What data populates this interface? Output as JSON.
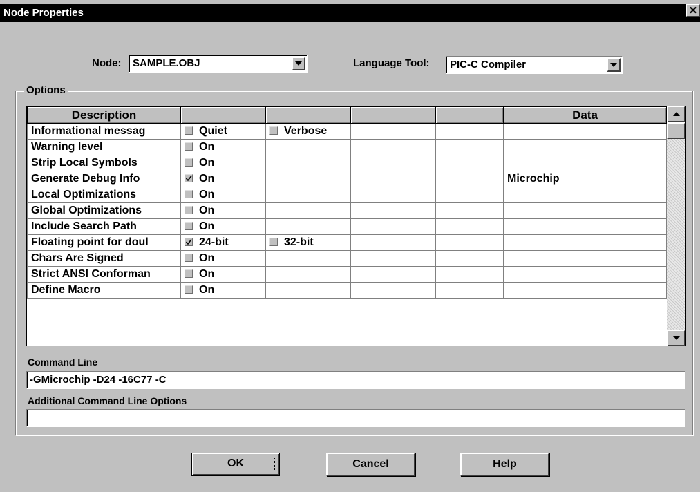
{
  "window": {
    "title": "Node Properties",
    "close_glyph": "✕"
  },
  "node": {
    "label": "Node:",
    "value": "SAMPLE.OBJ"
  },
  "language_tool": {
    "label": "Language Tool:",
    "value": "PIC-C Compiler"
  },
  "options": {
    "group_label": "Options",
    "columns": [
      "Description",
      "",
      "",
      "",
      "",
      "Data"
    ],
    "rows": [
      {
        "description": "Informational messag",
        "opt1": {
          "label": "Quiet",
          "checked": false
        },
        "opt2": {
          "label": "Verbose",
          "checked": false
        },
        "data": ""
      },
      {
        "description": "Warning level",
        "opt1": {
          "label": "On",
          "checked": false
        },
        "opt2": null,
        "data": ""
      },
      {
        "description": "Strip Local Symbols",
        "opt1": {
          "label": "On",
          "checked": false
        },
        "opt2": null,
        "data": ""
      },
      {
        "description": "Generate Debug Info",
        "opt1": {
          "label": "On",
          "checked": true
        },
        "opt2": null,
        "data": "Microchip"
      },
      {
        "description": "Local Optimizations",
        "opt1": {
          "label": "On",
          "checked": false
        },
        "opt2": null,
        "data": ""
      },
      {
        "description": "Global Optimizations",
        "opt1": {
          "label": "On",
          "checked": false
        },
        "opt2": null,
        "data": ""
      },
      {
        "description": "Include Search Path",
        "opt1": {
          "label": "On",
          "checked": false
        },
        "opt2": null,
        "data": ""
      },
      {
        "description": "Floating point for doul",
        "opt1": {
          "label": "24-bit",
          "checked": true
        },
        "opt2": {
          "label": "32-bit",
          "checked": false
        },
        "data": ""
      },
      {
        "description": "Chars Are Signed",
        "opt1": {
          "label": "On",
          "checked": false
        },
        "opt2": null,
        "data": ""
      },
      {
        "description": "Strict ANSI Conforman",
        "opt1": {
          "label": "On",
          "checked": false
        },
        "opt2": null,
        "data": ""
      },
      {
        "description": "Define Macro",
        "opt1": {
          "label": "On",
          "checked": false
        },
        "opt2": null,
        "data": ""
      }
    ]
  },
  "command_line": {
    "label": "Command Line",
    "value": "-GMicrochip -D24 -16C77 -C"
  },
  "additional_options": {
    "label": "Additional Command Line Options",
    "value": ""
  },
  "buttons": {
    "ok": "OK",
    "cancel": "Cancel",
    "help": "Help"
  },
  "icons": {
    "dropdown": "chevron-down-icon",
    "check": "checkmark-icon",
    "scroll_up": "arrow-up-icon",
    "scroll_down": "arrow-down-icon"
  }
}
